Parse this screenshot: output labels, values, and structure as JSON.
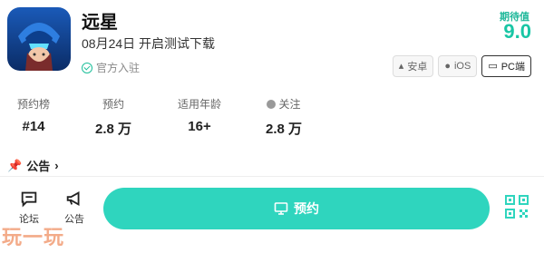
{
  "game": {
    "title": "远星",
    "release": "08月24日 开启测试下载",
    "official": "官方入驻"
  },
  "expect": {
    "label": "期待值",
    "score": "9.0"
  },
  "platforms": [
    {
      "label": "安卓",
      "icon": "android-icon"
    },
    {
      "label": "iOS",
      "icon": "apple-icon"
    },
    {
      "label": "PC端",
      "icon": "monitor-icon",
      "active": true
    }
  ],
  "stats": [
    {
      "label": "预约榜",
      "value": "#14"
    },
    {
      "label": "预约",
      "value": "2.8 万"
    },
    {
      "label": "适用年龄",
      "value": "16+"
    },
    {
      "label": "关注",
      "value": "2.8 万",
      "icon": "heart-icon"
    }
  ],
  "notice": {
    "label": "公告"
  },
  "bottom": {
    "forum": "论坛",
    "announce": "公告",
    "reserve": "预约"
  },
  "watermark": "玩一玩",
  "colors": {
    "accent": "#2fd5be",
    "score": "#19c6a5",
    "watermark": "#f19d75"
  }
}
